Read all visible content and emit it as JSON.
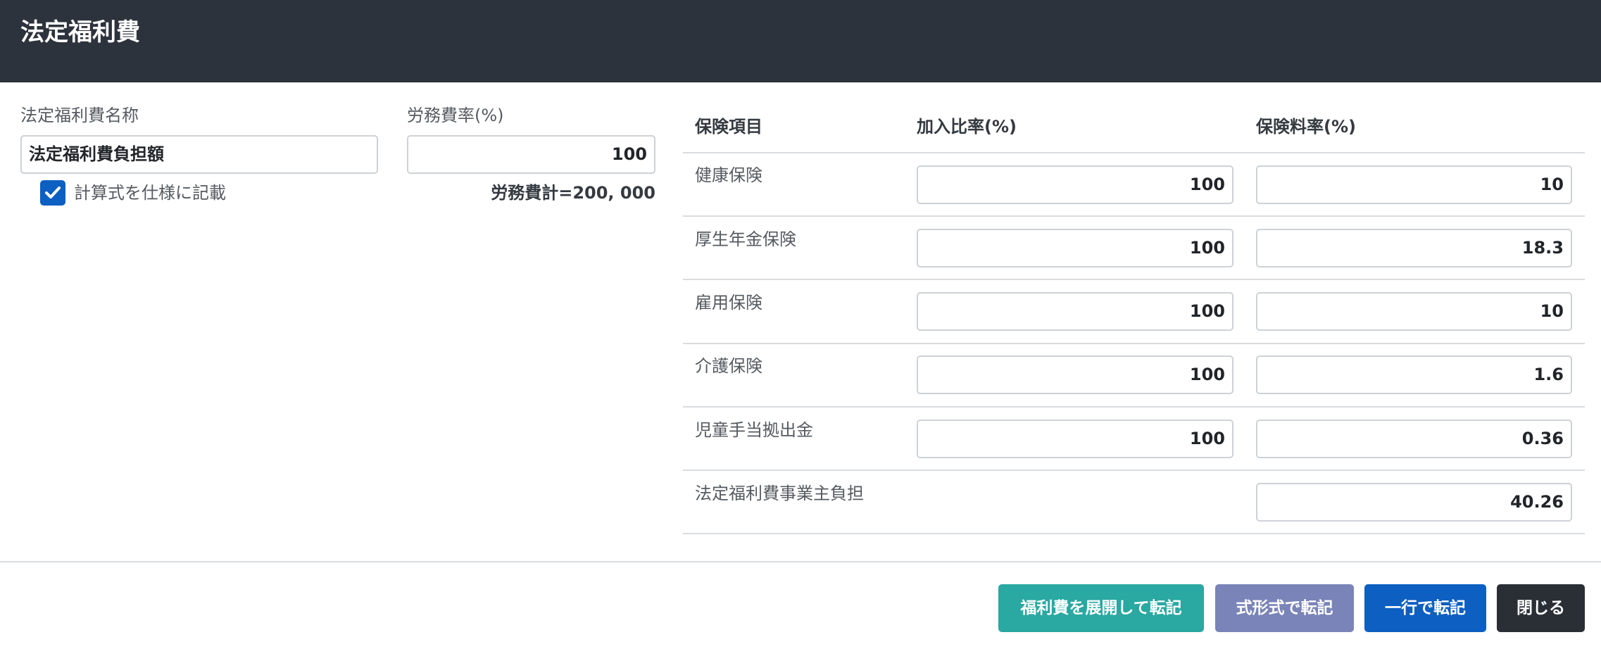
{
  "dialog": {
    "title": "法定福利費"
  },
  "left": {
    "name_label": "法定福利費名称",
    "name_value": "法定福利費負担額",
    "rate_label": "労務費率(%)",
    "rate_value": "100",
    "checkbox_label": "計算式を仕様に記載",
    "checkbox_checked": true,
    "labor_total": "労務費計=200, 000"
  },
  "table": {
    "headers": [
      "保険項目",
      "加入比率(%)",
      "保険料率(%)"
    ],
    "rows": [
      {
        "item": "健康保険",
        "ratio": "100",
        "rate": "10"
      },
      {
        "item": "厚生年金保険",
        "ratio": "100",
        "rate": "18.3"
      },
      {
        "item": "雇用保険",
        "ratio": "100",
        "rate": "10"
      },
      {
        "item": "介護保険",
        "ratio": "100",
        "rate": "1.6"
      },
      {
        "item": "児童手当拠出金",
        "ratio": "100",
        "rate": "0.36"
      },
      {
        "item": "法定福利費事業主負担",
        "ratio": "",
        "rate": "40.26"
      }
    ]
  },
  "buttons": {
    "expand": "福利費を展開して転記",
    "formula": "式形式で転記",
    "single_line": "一行で転記",
    "close": "閉じる"
  },
  "colors": {
    "header_bg": "#2d333c",
    "expand_btn": "#2aa8a2",
    "formula_btn": "#7a84b8",
    "single_line_btn": "#0d5fc2",
    "close_btn": "#2a2f36",
    "checkbox": "#0d5fc2"
  }
}
